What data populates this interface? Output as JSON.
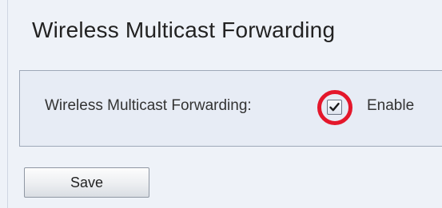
{
  "page": {
    "title": "Wireless Multicast Forwarding"
  },
  "settings": {
    "field_label": "Wireless Multicast Forwarding:",
    "checkbox_checked": true,
    "checkbox_option_label": "Enable",
    "highlight_color": "#e4172b"
  },
  "actions": {
    "save_label": "Save"
  },
  "icons": {
    "checkbox_mark": "checkmark-icon"
  }
}
